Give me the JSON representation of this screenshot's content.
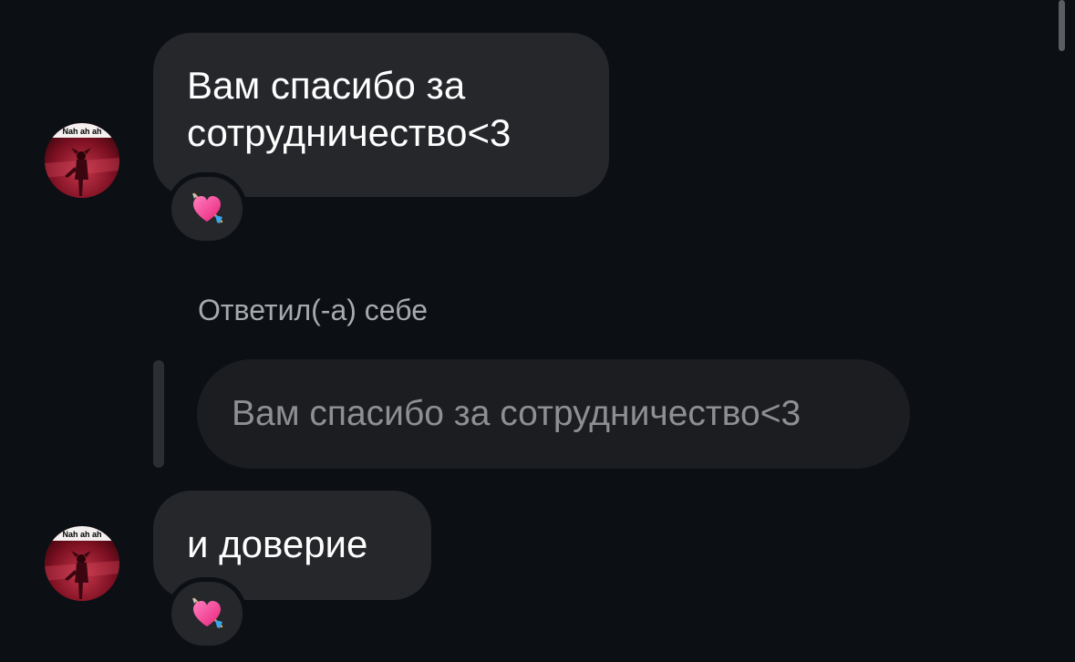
{
  "messages": [
    {
      "lines": [
        "Вам спасибо за",
        "сотрудничество<3"
      ],
      "reaction": "💘"
    },
    {
      "lines": [
        "и доверие"
      ],
      "reaction": "💘"
    }
  ],
  "reply": {
    "label": "Ответил(-а) себе",
    "quoted_text": "Вам спасибо за сотрудничество<3"
  },
  "avatar": {
    "caption": "Nah ah ah"
  },
  "colors": {
    "background": "#0c0f14",
    "bubble": "#26272b",
    "quoted_bubble": "#1c1d21",
    "secondary_text": "#a7a9ad"
  }
}
